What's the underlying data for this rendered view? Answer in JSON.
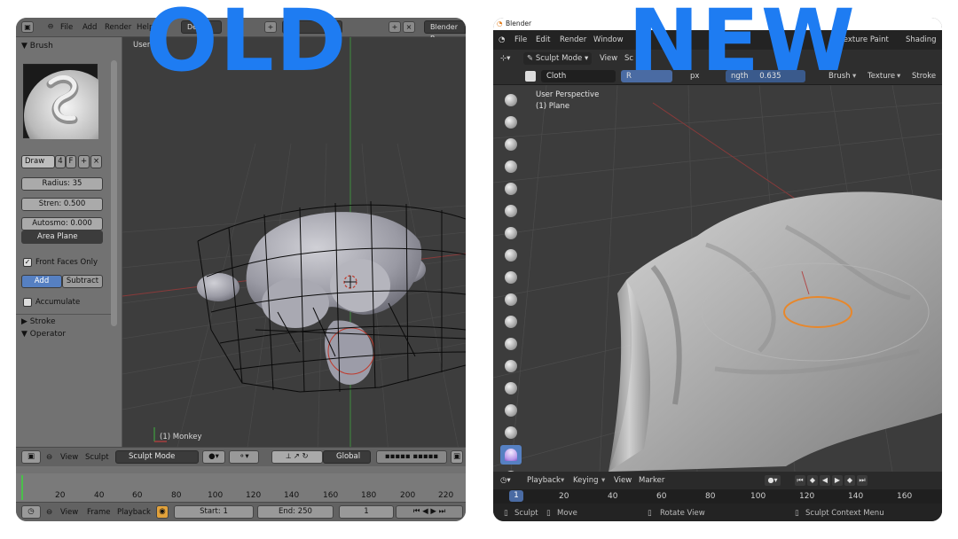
{
  "headline": {
    "old": "OLD",
    "new": "NEW"
  },
  "old_ui": {
    "menu": [
      "File",
      "Add",
      "Render",
      "Help"
    ],
    "screen_field": "De",
    "scene_field": "ce",
    "engine_field": "Blender R",
    "brush_panel_title": "Brush",
    "brush_name": "Draw",
    "brush_users": "4",
    "brush_fake": "F",
    "radius": "Radius: 35",
    "strength": "Stren: 0.500",
    "autosmooth": "Autosmo: 0.000",
    "sculpt_plane": "Area Plane",
    "front_faces": "Front Faces Only",
    "add": "Add",
    "subtract": "Subtract",
    "accumulate": "Accumulate",
    "stroke_panel": "Stroke",
    "operator_panel": "Operator",
    "viewport_label": "User",
    "object_label": "(1) Monkey",
    "header": {
      "view": "View",
      "sculpt": "Sculpt",
      "mode": "Sculpt Mode",
      "orientation": "Global"
    },
    "timeline_ticks": [
      "20",
      "40",
      "60",
      "80",
      "100",
      "120",
      "140",
      "160",
      "180",
      "200",
      "220"
    ],
    "playback_bar": {
      "view": "View",
      "frame": "Frame",
      "playback": "Playback",
      "start": "Start: 1",
      "end": "End: 250",
      "current": "1"
    }
  },
  "new_ui": {
    "window_title": "Blender",
    "menu": [
      "File",
      "Edit",
      "Render",
      "Window"
    ],
    "workspaces": [
      "Texture Paint",
      "Shading"
    ],
    "mode": "Sculpt Mode",
    "mode_menu": [
      "View",
      "Sc"
    ],
    "brush_name": "Cloth",
    "header_right": [
      "Brush",
      "Texture",
      "Stroke"
    ],
    "header_fragments": [
      "R",
      "px",
      "ngth",
      "0.635"
    ],
    "viewport_lines": [
      "User Perspective",
      "(1) Plane"
    ],
    "timeline_menu": [
      "Playback",
      "Keying",
      "View",
      "Marker"
    ],
    "current_frame": "1",
    "ruler_ticks": [
      "20",
      "40",
      "60",
      "80",
      "100",
      "120",
      "140",
      "160"
    ],
    "status": [
      "Sculpt",
      "Move",
      "Rotate View",
      "Sculpt Context Menu"
    ],
    "accent_color": "#5680c2",
    "brush_cursor_color": "#e8872a"
  }
}
